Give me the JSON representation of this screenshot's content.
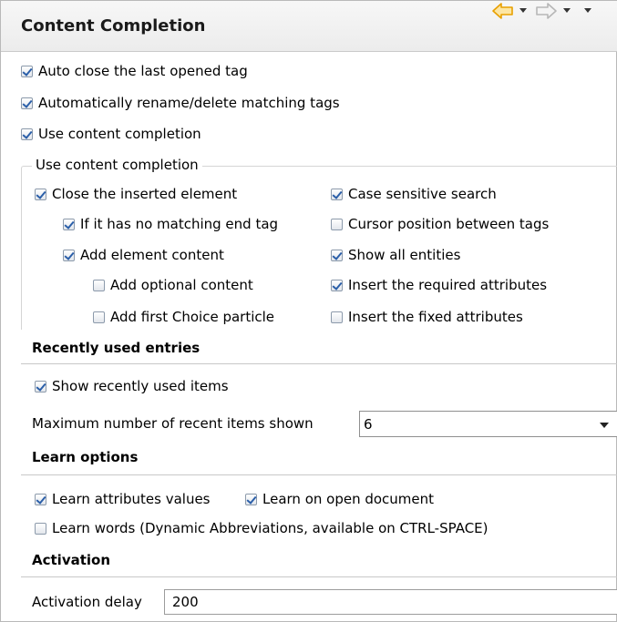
{
  "header": {
    "title": "Content Completion",
    "back_icon": "back-arrow-icon",
    "forward_icon": "forward-arrow-icon",
    "accent_color": "#e8a000"
  },
  "general": {
    "auto_close": {
      "label": "Auto close the last opened tag",
      "checked": true
    },
    "auto_rename": {
      "label": "Automatically rename/delete matching tags",
      "checked": true
    },
    "use_completion": {
      "label": "Use content completion",
      "checked": true
    }
  },
  "completion_group": {
    "title": "Use content completion",
    "close_inserted": {
      "label": "Close the inserted element",
      "checked": true
    },
    "no_matching_end": {
      "label": "If it has no matching end tag",
      "checked": true
    },
    "add_element_content": {
      "label": "Add element content",
      "checked": true
    },
    "add_optional": {
      "label": "Add optional content",
      "checked": false
    },
    "add_first_choice": {
      "label": "Add first Choice particle",
      "checked": false
    },
    "case_sensitive": {
      "label": "Case sensitive search",
      "checked": true
    },
    "cursor_between": {
      "label": "Cursor position between tags",
      "checked": false
    },
    "show_entities": {
      "label": "Show all entities",
      "checked": true
    },
    "insert_required": {
      "label": "Insert the required attributes",
      "checked": true
    },
    "insert_fixed": {
      "label": "Insert the fixed attributes",
      "checked": false
    }
  },
  "recent": {
    "section_title": "Recently used entries",
    "show_recent": {
      "label": "Show recently used items",
      "checked": true
    },
    "max_label": "Maximum number of recent items shown",
    "max_value": "6"
  },
  "learn": {
    "section_title": "Learn options",
    "learn_attrs": {
      "label": "Learn attributes values",
      "checked": true
    },
    "learn_open": {
      "label": "Learn on open document",
      "checked": true
    },
    "learn_words": {
      "label": "Learn words (Dynamic Abbreviations, available on CTRL-SPACE)",
      "checked": false
    }
  },
  "activation": {
    "section_title": "Activation",
    "delay_label": "Activation delay",
    "delay_value": "200"
  }
}
